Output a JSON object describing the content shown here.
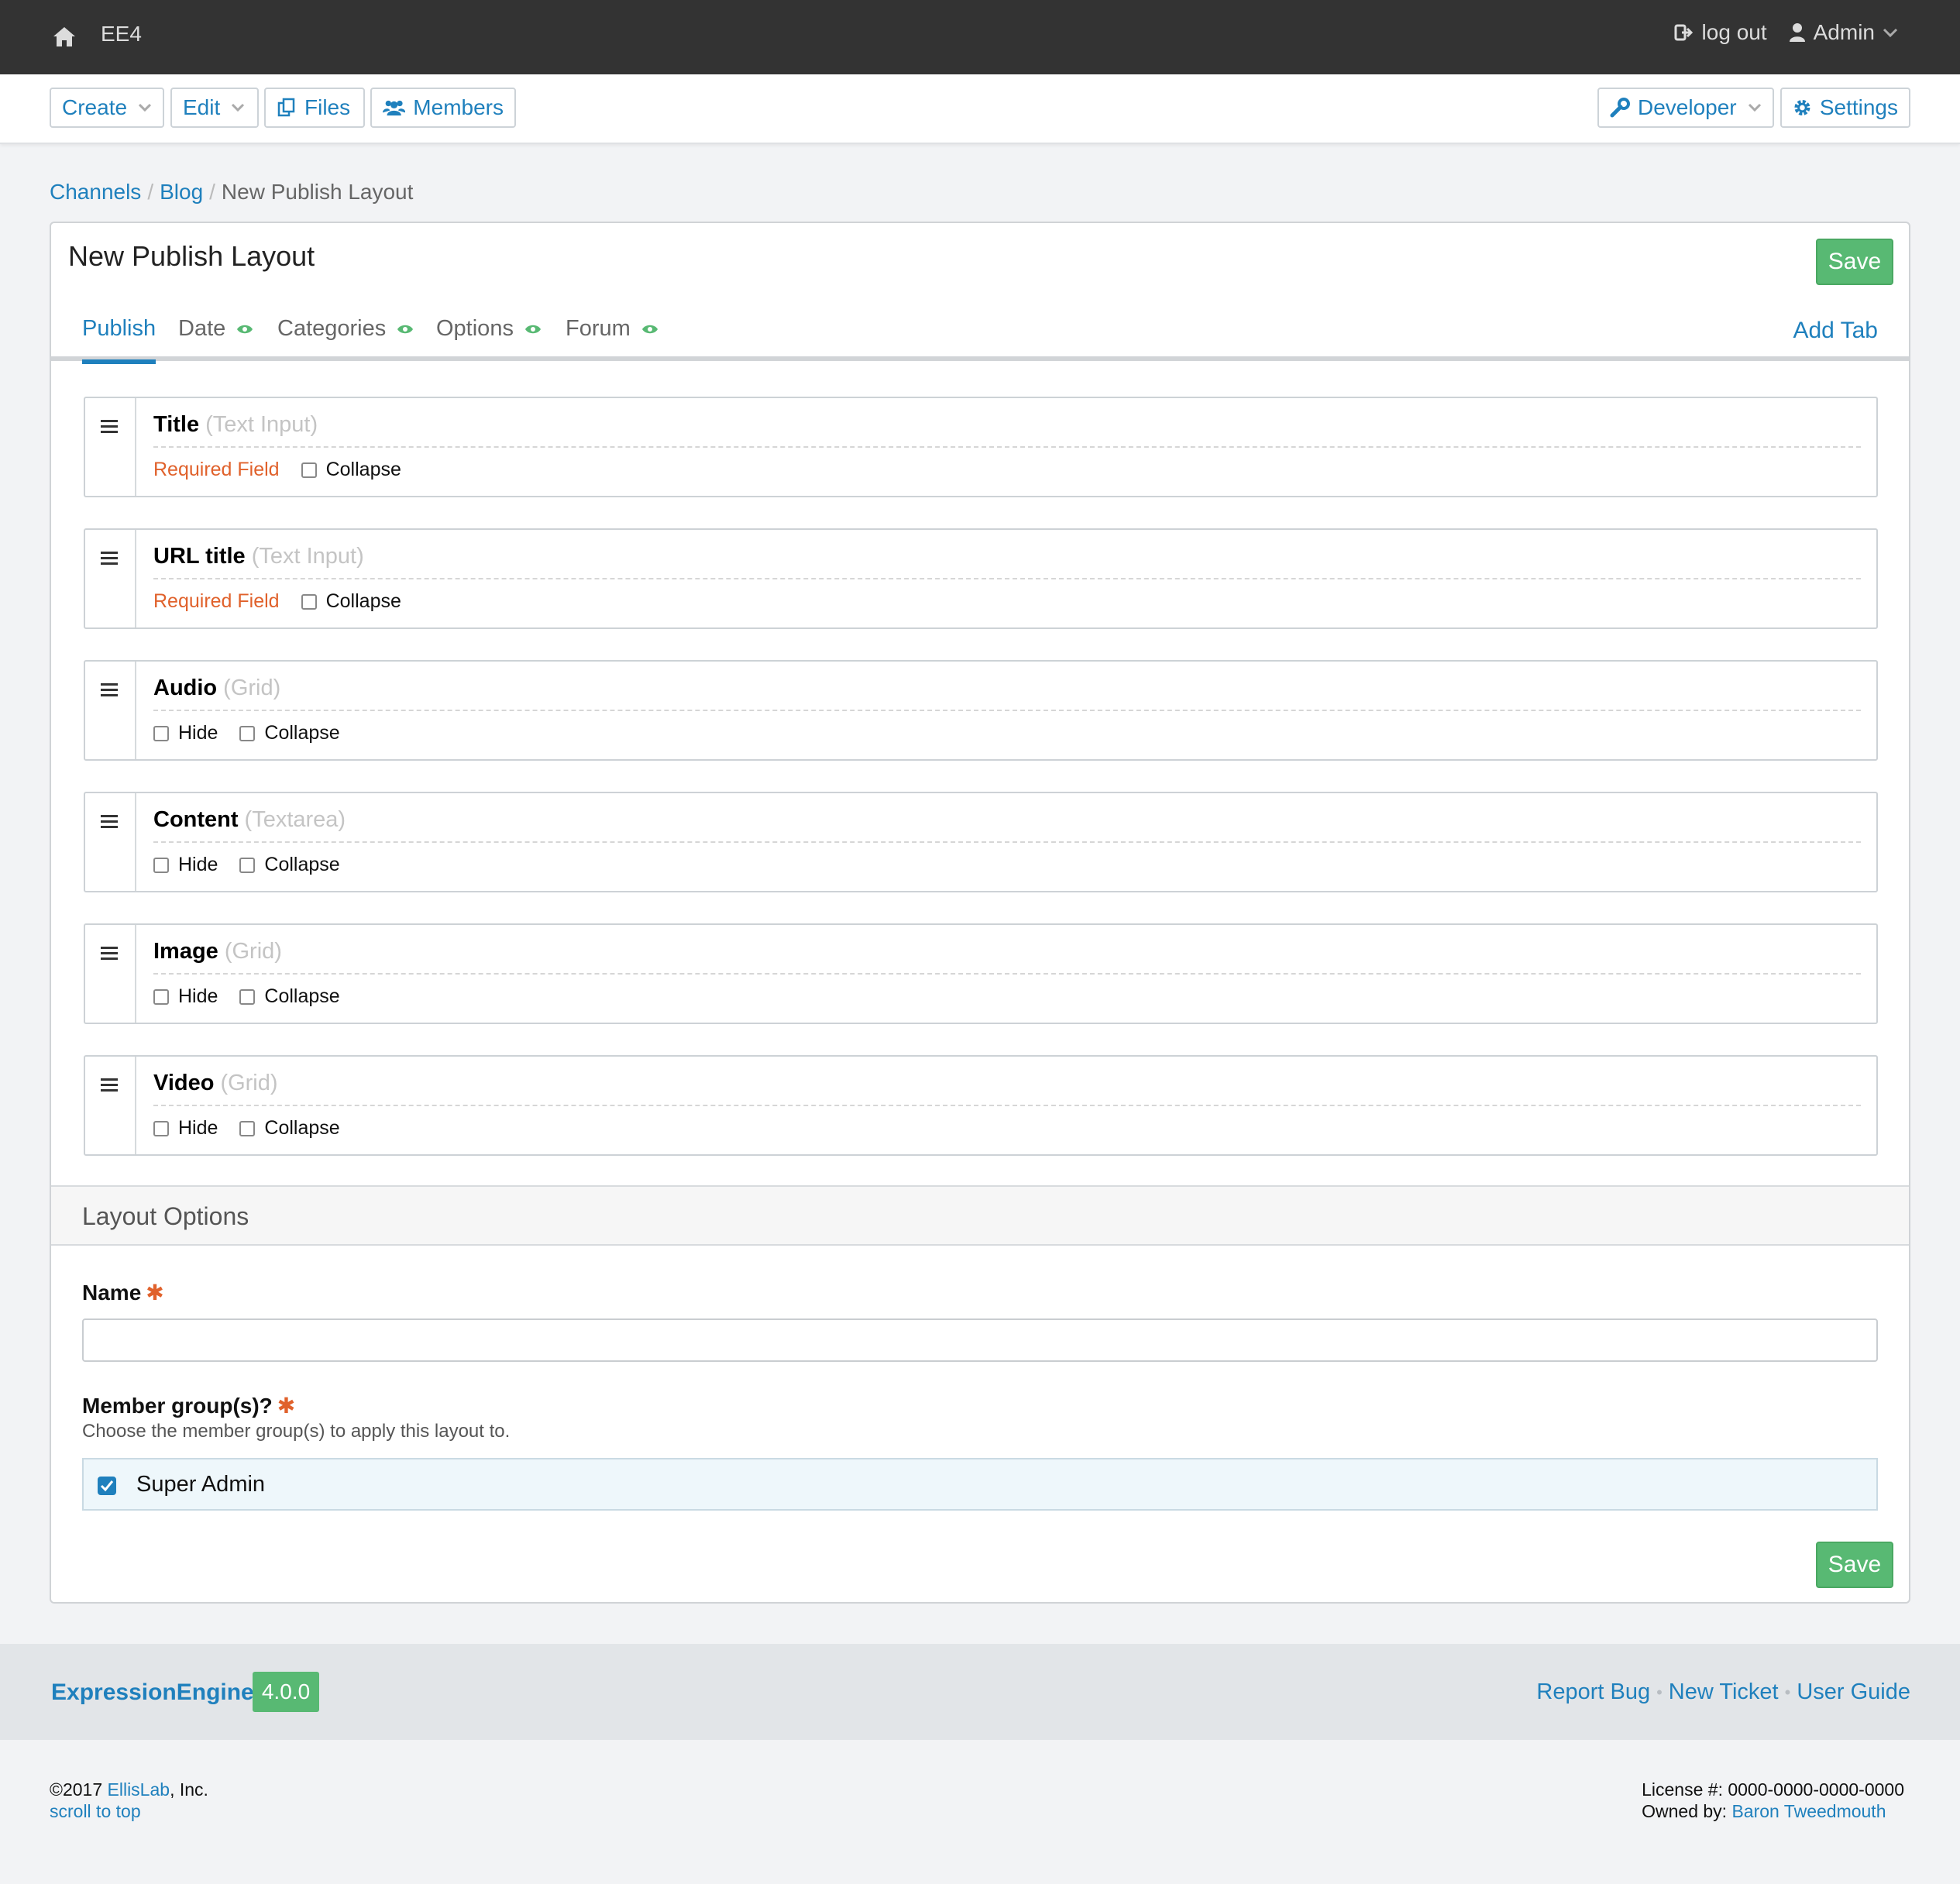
{
  "topbar": {
    "home_icon": "home-icon",
    "site_name": "EE4",
    "logout_label": "log out",
    "user_label": "Admin"
  },
  "nav": {
    "create": "Create",
    "edit": "Edit",
    "files": "Files",
    "members": "Members",
    "developer": "Developer",
    "settings": "Settings"
  },
  "breadcrumb": {
    "channels": "Channels",
    "blog": "Blog",
    "current": "New Publish Layout"
  },
  "page": {
    "title": "New Publish Layout",
    "save_label": "Save",
    "add_tab": "Add Tab",
    "tabs": [
      {
        "label": "Publish",
        "active": true
      },
      {
        "label": "Date",
        "visible_icon": "eye-icon"
      },
      {
        "label": "Categories",
        "visible_icon": "eye-icon"
      },
      {
        "label": "Options",
        "visible_icon": "eye-icon"
      },
      {
        "label": "Forum",
        "visible_icon": "eye-icon"
      }
    ]
  },
  "fields": [
    {
      "name": "Title",
      "type": "(Text Input)",
      "required_label": "Required Field",
      "collapse_label": "Collapse"
    },
    {
      "name": "URL title",
      "type": "(Text Input)",
      "required_label": "Required Field",
      "collapse_label": "Collapse"
    },
    {
      "name": "Audio",
      "type": "(Grid)",
      "hide_label": "Hide",
      "collapse_label": "Collapse"
    },
    {
      "name": "Content",
      "type": "(Textarea)",
      "hide_label": "Hide",
      "collapse_label": "Collapse"
    },
    {
      "name": "Image",
      "type": "(Grid)",
      "hide_label": "Hide",
      "collapse_label": "Collapse"
    },
    {
      "name": "Video",
      "type": "(Grid)",
      "hide_label": "Hide",
      "collapse_label": "Collapse"
    }
  ],
  "layout_options": {
    "heading": "Layout Options",
    "name_label": "Name",
    "name_value": "",
    "groups_label": "Member group(s)?",
    "groups_desc": "Choose the member group(s) to apply this layout to.",
    "group_option": "Super Admin",
    "group_checked": true
  },
  "footer": {
    "brand": "ExpressionEngine",
    "version": "4.0.0",
    "report_bug": "Report Bug",
    "new_ticket": "New Ticket",
    "user_guide": "User Guide",
    "copyright_prefix": "©2017 ",
    "company": "EllisLab",
    "copyright_suffix": ", Inc.",
    "scroll_top": "scroll to top",
    "license": "License #: 0000-0000-0000-0000",
    "owned_by": "Owned by: ",
    "owner": "Baron Tweedmouth"
  },
  "colors": {
    "accent": "#1f80bd",
    "success": "#58b973",
    "required": "#e0612b",
    "topbar": "#333333"
  }
}
